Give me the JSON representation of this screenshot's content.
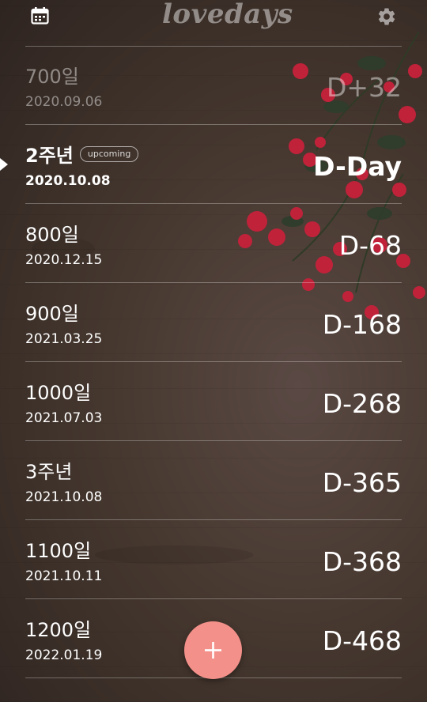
{
  "app": {
    "logo": "lovedays"
  },
  "header": {
    "calendar_icon": "calendar-icon",
    "settings_icon": "gear-icon"
  },
  "items": [
    {
      "title": "700일",
      "date": "2020.09.06",
      "dday": "D+32",
      "state": "past"
    },
    {
      "title": "2주년",
      "date": "2020.10.08",
      "dday": "D-Day",
      "state": "current",
      "badge": "upcoming"
    },
    {
      "title": "800일",
      "date": "2020.12.15",
      "dday": "D-68",
      "state": "future"
    },
    {
      "title": "900일",
      "date": "2021.03.25",
      "dday": "D-168",
      "state": "future"
    },
    {
      "title": "1000일",
      "date": "2021.07.03",
      "dday": "D-268",
      "state": "future"
    },
    {
      "title": "3주년",
      "date": "2021.10.08",
      "dday": "D-365",
      "state": "future"
    },
    {
      "title": "1100일",
      "date": "2021.10.11",
      "dday": "D-368",
      "state": "future"
    },
    {
      "title": "1200일",
      "date": "2022.01.19",
      "dday": "D-468",
      "state": "future"
    }
  ],
  "fab": {
    "icon": "plus-icon"
  },
  "colors": {
    "fab": "#f4908a",
    "background": "#46382f",
    "flower": "#c0223a"
  }
}
